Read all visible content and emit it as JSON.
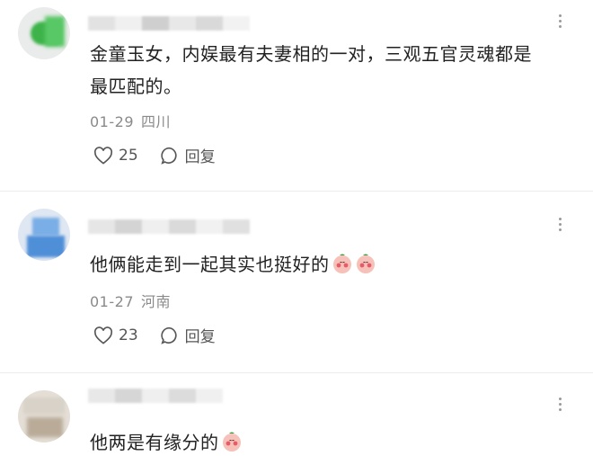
{
  "comments": [
    {
      "text": "金童玉女，内娱最有夫妻相的一对，三观五官灵魂都是最匹配的。",
      "line1": "金童玉女，内娱最有夫妻相的一对，三观五官灵魂都是",
      "line2": "最匹配的。",
      "date": "01-29",
      "location": "四川",
      "likes": "25",
      "reply_label": "回复"
    },
    {
      "text": "他俩能走到一起其实也挺好的",
      "date": "01-27",
      "location": "河南",
      "likes": "23",
      "reply_label": "回复",
      "emoji": [
        "blushing-face-icon",
        "blushing-face-icon"
      ]
    },
    {
      "text": "他两是有缘分的",
      "emoji": [
        "blushing-face-icon"
      ]
    }
  ],
  "colors": {
    "meta_gray": "#8a8a8a",
    "avatar1_green": "#3db34a",
    "avatar2_blue": "#4f8fd8"
  }
}
